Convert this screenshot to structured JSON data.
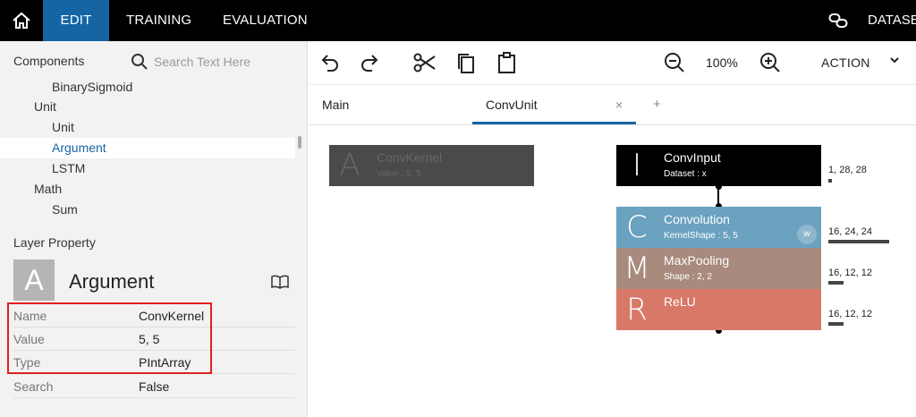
{
  "nav": {
    "tabs": [
      {
        "label": "EDIT",
        "active": true
      },
      {
        "label": "TRAINING",
        "active": false
      },
      {
        "label": "EVALUATION",
        "active": false
      }
    ],
    "dataset_label": "DATASE",
    "icons": {
      "home": "home-icon",
      "dataset": "link-icon"
    }
  },
  "components": {
    "header": "Components",
    "search_placeholder": "Search Text Here",
    "tree": [
      {
        "label": "BinarySigmoid",
        "level": 3
      },
      {
        "label": "Unit",
        "level": 2
      },
      {
        "label": "Unit",
        "level": 3
      },
      {
        "label": "Argument",
        "level": 3,
        "selected": true
      },
      {
        "label": "LSTM",
        "level": 3
      },
      {
        "label": "Math",
        "level": 2
      },
      {
        "label": "Sum",
        "level": 3
      }
    ]
  },
  "layer_property": {
    "title": "Layer Property",
    "icon_letter": "A",
    "name": "Argument",
    "properties": [
      {
        "key": "Name",
        "value": "ConvKernel"
      },
      {
        "key": "Value",
        "value": "5, 5"
      },
      {
        "key": "Type",
        "value": "PIntArray"
      },
      {
        "key": "Search",
        "value": "False"
      }
    ]
  },
  "toolbar": {
    "zoom": "100%",
    "action_label": "ACTION",
    "icons": [
      "undo-icon",
      "redo-icon",
      "cut-icon",
      "copy-icon",
      "paste-icon",
      "zoom-out-icon",
      "zoom-in-icon"
    ]
  },
  "tabs": {
    "main_label": "Main",
    "active_label": "ConvUnit",
    "close_symbol": "×",
    "add_symbol": "+"
  },
  "graph": {
    "argument_node": {
      "letter": "A",
      "title": "ConvKernel",
      "subtitle": "Value : 5, 5"
    },
    "nodes": [
      {
        "letter": "I",
        "title": "ConvInput",
        "subtitle": "Dataset : x",
        "shape": "1, 28, 28",
        "shape_fill": 0.02,
        "color": "#000000"
      },
      {
        "letter": "C",
        "title": "Convolution",
        "subtitle": "KernelShape : 5, 5",
        "shape": "16, 24, 24",
        "shape_fill": 1.0,
        "color": "#6aa2c0",
        "badge": "w"
      },
      {
        "letter": "M",
        "title": "MaxPooling",
        "subtitle": "Shape : 2, 2",
        "shape": "16, 12, 12",
        "shape_fill": 0.25,
        "color": "#a88b7c"
      },
      {
        "letter": "R",
        "title": "ReLU",
        "subtitle": "",
        "shape": "16, 12, 12",
        "shape_fill": 0.25,
        "color": "#d87868"
      }
    ]
  }
}
